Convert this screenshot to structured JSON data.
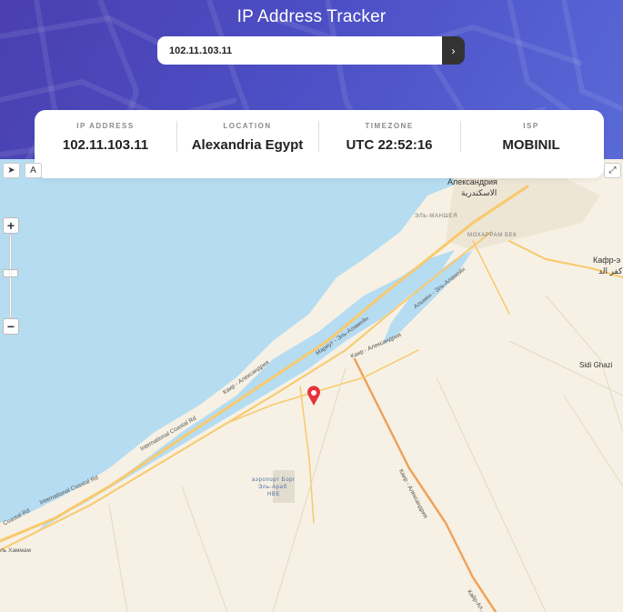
{
  "header": {
    "title": "IP Address Tracker",
    "search_value": "102.11.103.11",
    "go_icon": "chevron-right-icon"
  },
  "info": {
    "ip_label": "IP ADDRESS",
    "ip_value": "102.11.103.11",
    "location_label": "LOCATION",
    "location_value": "Alexandria Egypt",
    "timezone_label": "TIMEZONE",
    "timezone_value": "UTC 22:52:16",
    "isp_label": "ISP",
    "isp_value": "MOBINIL"
  },
  "map": {
    "zoom_in": "+",
    "zoom_out": "−",
    "locate_icon": "navigation-arrow-icon",
    "layers_label": "A",
    "fullscreen_icon": "expand-icon",
    "marker_icon": "map-pin-icon",
    "labels": {
      "alexandria_ru": "Александрия",
      "alexandria_ar": "الاسكندرية",
      "el_manshi": "ЭЛЬ-МАНШЕЯ",
      "moharram_bek": "МОХАРРАМ БЕК",
      "kafr_ru": "Кафр-э",
      "kafr_ar": "كفر الد",
      "sidi_ghazi": "Sidi Ghazi",
      "airport_ru": "аэропорт Борг",
      "airport_ru2": "Эль-Араб",
      "airport_code": "HBE",
      "hammam": "ль Хаммам",
      "road_international_1": "International Coastal Rd",
      "road_international_2": "International Coastal Rd",
      "road_kairo": "Каир - Александрия",
      "road_kairo2": "Каир - Александрия",
      "road_cairo_alex": "Каир - Александрия",
      "road_kitay": "Кайр-Ал...",
      "road_alamein": "Альмен - Эль-Аламейн",
      "road_mariut": "Мариут - Эль-Аламейн",
      "road_coastal": "Coastal Rd",
      "road_kafr": "Кафр-..."
    }
  },
  "colors": {
    "header_start": "#4a3fb0",
    "header_end": "#5a6ad8",
    "sea": "#b5dcf1",
    "land": "#f6f1e4",
    "road_major": "#f9c96b",
    "marker": "#e8333a"
  }
}
